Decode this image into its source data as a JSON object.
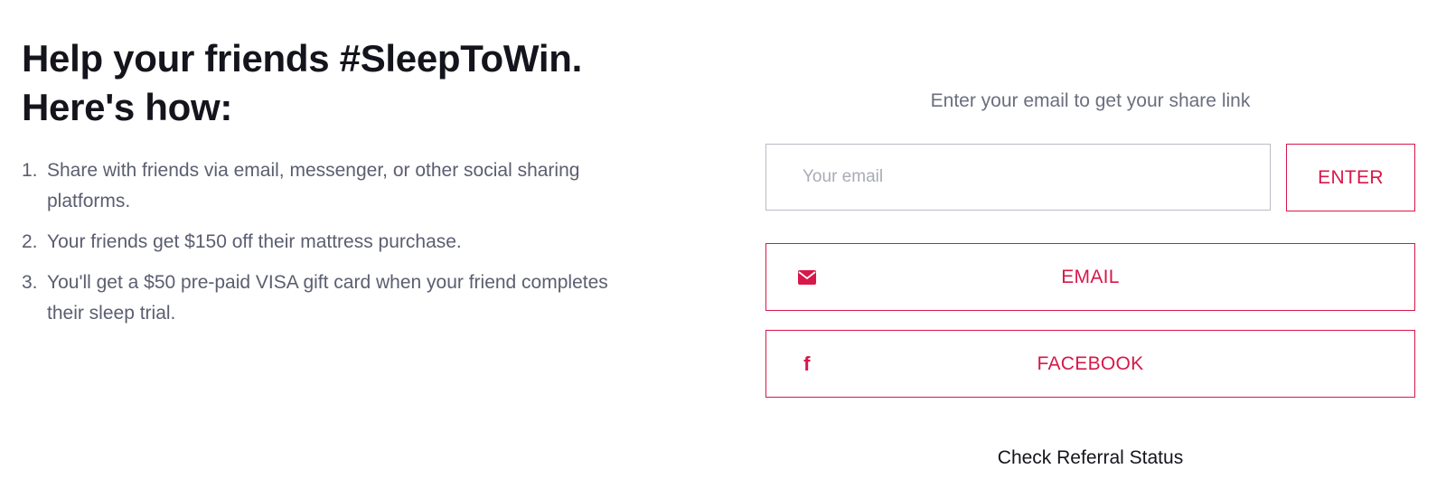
{
  "heading": {
    "line1": "Help your friends #SleepToWin.",
    "line2": "Here's how:"
  },
  "steps": [
    {
      "number": "1.",
      "text": "Share with friends via email, messenger, or other social sharing platforms."
    },
    {
      "number": "2.",
      "text": "Your friends get $150 off their mattress purchase."
    },
    {
      "number": "3.",
      "text": "You'll get a $50 pre-paid VISA gift card when your friend completes their sleep trial."
    }
  ],
  "share": {
    "prompt": "Enter your email to get your share link",
    "email_placeholder": "Your email",
    "email_value": "",
    "enter_label": "ENTER",
    "email_button_label": "EMAIL",
    "email_icon": "envelope-icon",
    "facebook_button_label": "FACEBOOK",
    "facebook_icon": "facebook-icon",
    "referral_link": "Check Referral Status"
  },
  "colors": {
    "accent": "#d8174a",
    "heading": "#14141c",
    "body_text": "#5b5e70",
    "input_border": "#b9bcc4"
  }
}
